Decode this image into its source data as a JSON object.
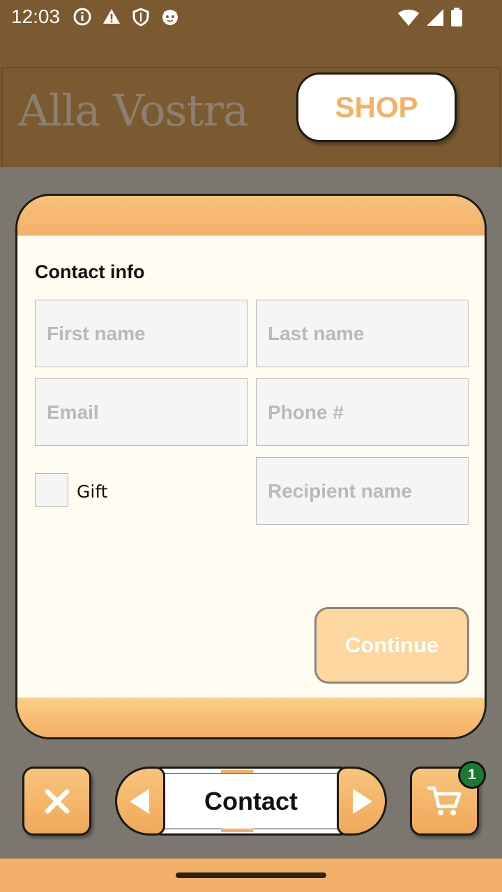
{
  "status_bar": {
    "time": "12:03",
    "left_icons": [
      "info-icon",
      "warning-icon",
      "shield-icon",
      "cat-icon"
    ],
    "right_icons": [
      "wifi-icon",
      "signal-icon",
      "battery-icon"
    ]
  },
  "header": {
    "brand": "Alla Vostra",
    "shop_label": "SHOP"
  },
  "form": {
    "title": "Contact info",
    "first_name_placeholder": "First name",
    "last_name_placeholder": "Last name",
    "email_placeholder": "Email",
    "phone_placeholder": "Phone #",
    "gift_label": "Gift",
    "gift_checked": false,
    "recipient_placeholder": "Recipient name",
    "continue_label": "Continue"
  },
  "toolbar": {
    "step_label": "Contact",
    "cart_count": "1"
  },
  "colors": {
    "brown": "#7b5a32",
    "accent_orange": "#f3b06a",
    "cart_badge": "#1b7a32"
  }
}
